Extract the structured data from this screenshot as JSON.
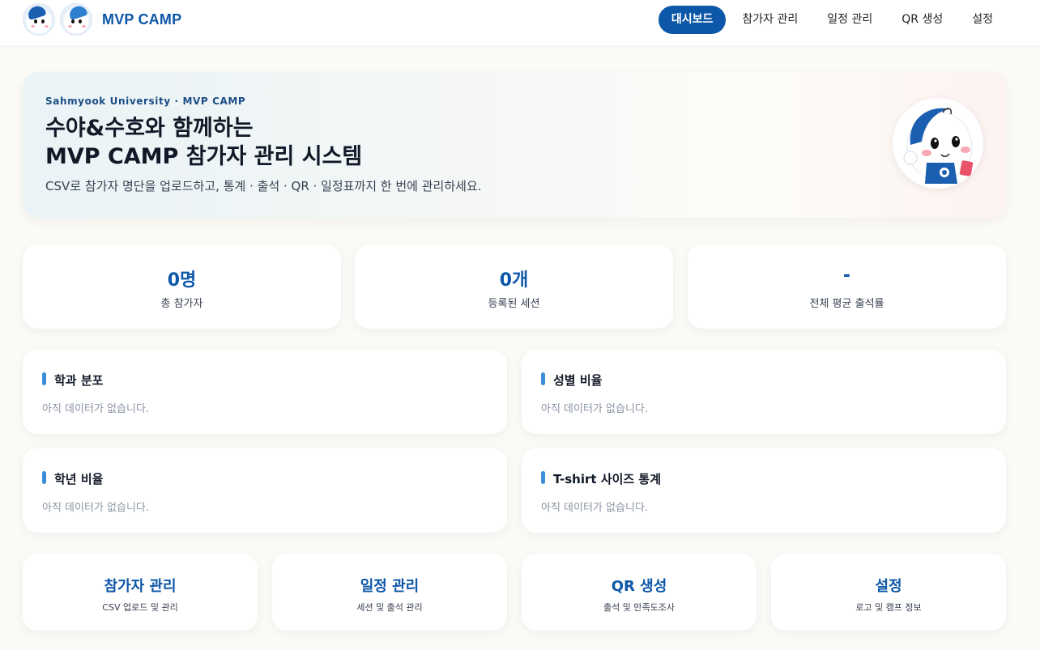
{
  "header": {
    "brand": "MVP CAMP",
    "nav": [
      {
        "label": "대시보드",
        "active": true
      },
      {
        "label": "참가자 관리",
        "active": false
      },
      {
        "label": "일정 관리",
        "active": false
      },
      {
        "label": "QR 생성",
        "active": false
      },
      {
        "label": "설정",
        "active": false
      }
    ]
  },
  "hero": {
    "eyebrow": "Sahmyook University · MVP CAMP",
    "title_line1": "수야&수호와 함께하는",
    "title_line2": "MVP CAMP 참가자 관리 시스템",
    "subtitle": "CSV로 참가자 명단을 업로드하고, 통계 · 출석 · QR · 일정표까지 한 번에 관리하세요."
  },
  "stats": [
    {
      "value": "0명",
      "label": "총 참가자"
    },
    {
      "value": "0개",
      "label": "등록된 세션"
    },
    {
      "value": "-",
      "label": "전체 평균 출석률"
    }
  ],
  "panels": [
    {
      "title": "학과 분포",
      "empty": "아직 데이터가 없습니다."
    },
    {
      "title": "성별 비율",
      "empty": "아직 데이터가 없습니다."
    },
    {
      "title": "학년 비율",
      "empty": "아직 데이터가 없습니다."
    },
    {
      "title": "T-shirt 사이즈 통계",
      "empty": "아직 데이터가 없습니다."
    }
  ],
  "quick_links": [
    {
      "title": "참가자 관리",
      "sub": "CSV 업로드 및 관리"
    },
    {
      "title": "일정 관리",
      "sub": "세션 및 출석 관리"
    },
    {
      "title": "QR 생성",
      "sub": "출석 및 만족도조사"
    },
    {
      "title": "설정",
      "sub": "로고 및 캠프 정보"
    }
  ],
  "colors": {
    "primary": "#0d57a8",
    "accent_bar": "#3a8fd8",
    "page_bg": "#fbfaf6"
  }
}
